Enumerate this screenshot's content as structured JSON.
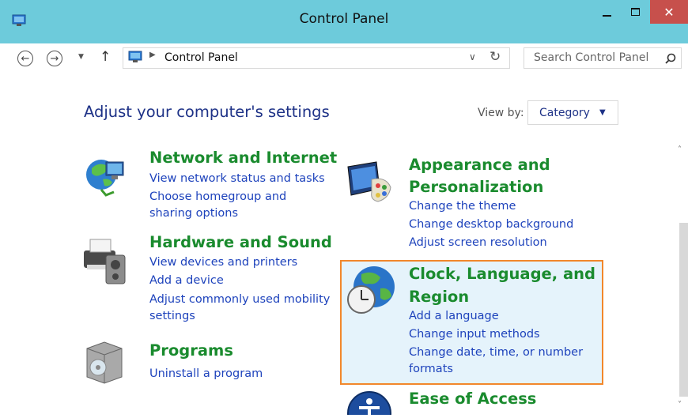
{
  "window": {
    "title": "Control Panel",
    "close_glyph": "✕"
  },
  "nav": {
    "breadcrumb": "Control Panel",
    "search_placeholder": "Search Control Panel"
  },
  "header": {
    "title": "Adjust your computer's settings",
    "view_by_label": "View by:",
    "view_by_value": "Category"
  },
  "categories": [
    {
      "icon": "network-globe-icon",
      "title": "Network and Internet",
      "links": [
        "View network status and tasks",
        "Choose homegroup and",
        "sharing options"
      ]
    },
    {
      "icon": "printer-speaker-icon",
      "title": "Hardware and Sound",
      "links": [
        "View devices and printers",
        "Add a device",
        "Adjust commonly used mobility",
        "settings"
      ]
    },
    {
      "icon": "programs-box-icon",
      "title": "Programs",
      "links": [
        "Uninstall a program"
      ]
    },
    {
      "icon": "monitor-palette-icon",
      "title": [
        "Appearance and",
        "Personalization"
      ],
      "links": [
        "Change the theme",
        "Change desktop background",
        "Adjust screen resolution"
      ]
    },
    {
      "icon": "clock-globe-icon",
      "title": [
        "Clock, Language, and",
        "Region"
      ],
      "links": [
        "Add a language",
        "Change input methods",
        "Change date, time, or number",
        "formats"
      ],
      "highlighted": true
    },
    {
      "icon": "ease-of-access-icon",
      "title": "Ease of Access",
      "links": []
    }
  ],
  "colors": {
    "titlebar": "#6dcbdb",
    "close": "#c7504c",
    "heading": "#1a8b2e",
    "link": "#1e43bc",
    "page_title": "#1e3287",
    "highlight_border": "#f2872b",
    "highlight_fill": "#e5f3fb"
  }
}
